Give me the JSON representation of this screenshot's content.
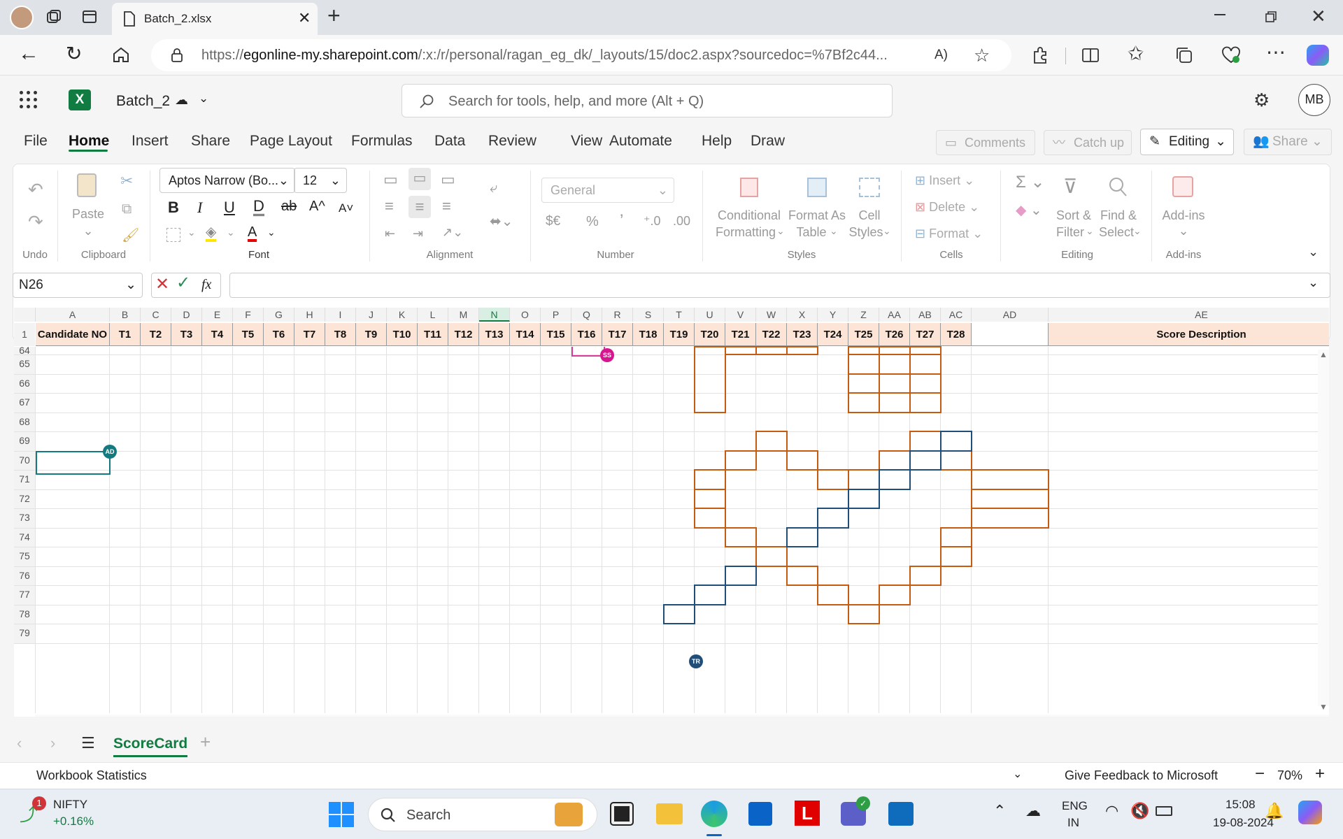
{
  "browser": {
    "tab_title": "Batch_2.xlsx",
    "url_prefix": "https://",
    "url_host": "egonline-my.sharepoint.com",
    "url_path": "/:x:/r/personal/ragan_eg_dk/_layouts/15/doc2.aspx?sourcedoc=%7Bf2c44...",
    "read_aloud": "A)"
  },
  "excel": {
    "file_name": "Batch_2",
    "search_placeholder": "Search for tools, help, and more (Alt + Q)",
    "user_initials": "MB",
    "menu": [
      "File",
      "Home",
      "Insert",
      "Share",
      "Page Layout",
      "Formulas",
      "Data",
      "Review",
      "View",
      "Automate",
      "Help",
      "Draw"
    ],
    "active_menu": "Home",
    "comments": "Comments",
    "catchup": "Catch up",
    "editing": "Editing",
    "share": "Share"
  },
  "ribbon": {
    "undo": "Undo",
    "clipboard": "Clipboard",
    "paste": "Paste",
    "font_name": "Aptos Narrow (Bo...",
    "font_size": "12",
    "font": "Font",
    "alignment": "Alignment",
    "number_format": "General",
    "number": "Number",
    "cond_fmt_1": "Conditional",
    "cond_fmt_2": "Formatting",
    "fmt_table_1": "Format As",
    "fmt_table_2": "Table",
    "cell_styles_1": "Cell",
    "cell_styles_2": "Styles",
    "styles": "Styles",
    "insert": "Insert",
    "delete": "Delete",
    "format": "Format",
    "cells": "Cells",
    "sort_1": "Sort &",
    "sort_2": "Filter",
    "find_1": "Find &",
    "find_2": "Select",
    "editing": "Editing",
    "addins_1": "Add-ins",
    "addins": "Add-ins",
    "currency": "$€",
    "percent": "%",
    "comma": "’"
  },
  "formula_bar": {
    "name_box": "N26",
    "fx": "fx"
  },
  "columns": [
    "A",
    "B",
    "C",
    "D",
    "E",
    "F",
    "G",
    "H",
    "I",
    "J",
    "K",
    "L",
    "M",
    "N",
    "O",
    "P",
    "Q",
    "R",
    "S",
    "T",
    "U",
    "V",
    "W",
    "X",
    "Y",
    "Z",
    "AA",
    "AB",
    "AC",
    "AD",
    "AE"
  ],
  "header_row": {
    "row_num": "1",
    "cells": [
      "Candidate NO",
      "T1",
      "T2",
      "T3",
      "T4",
      "T5",
      "T6",
      "T7",
      "T8",
      "T9",
      "T10",
      "T11",
      "T12",
      "T13",
      "T14",
      "T15",
      "T16",
      "T17",
      "T18",
      "T19",
      "T20",
      "T21",
      "T22",
      "T23",
      "T24",
      "T25",
      "T26",
      "T27",
      "T28",
      "",
      "Score Description"
    ]
  },
  "rows": [
    "64",
    "65",
    "66",
    "67",
    "68",
    "69",
    "70",
    "71",
    "72",
    "73",
    "74",
    "75",
    "76",
    "77",
    "78",
    "79"
  ],
  "presence": {
    "ss": "SS",
    "ad": "AD",
    "tr": "TR"
  },
  "sheet_tabs": {
    "active": "ScoreCard"
  },
  "status": {
    "left": "Workbook Statistics",
    "feedback": "Give Feedback to Microsoft",
    "zoom": "70%"
  },
  "taskbar": {
    "nifty": "NIFTY",
    "nifty_change": "+0.16%",
    "badge": "1",
    "search": "Search",
    "lang1": "ENG",
    "lang2": "IN",
    "time": "15:08",
    "date": "19-08-2024"
  }
}
